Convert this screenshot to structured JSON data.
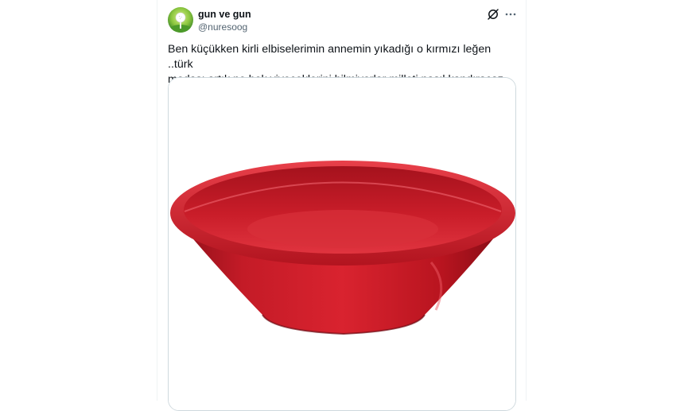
{
  "tweet": {
    "display_name": "gun ve gun",
    "handle": "@nuresoog",
    "text": "Ben küçükken kirli elbiselerimin annemin yıkadığı o kırmızı leğen ..türk\nmodası artık ne bok yiyeceklerini bilmiyorlar milleti nasıl kandıracaz diye",
    "avatar_icon": "golf-ball-on-tee-avatar",
    "media_subject": "red plastic basin",
    "colors": {
      "basin_red": "#cc1f2b",
      "text": "#0f1419",
      "secondary_text": "#536471",
      "border": "#cfd9de"
    }
  }
}
